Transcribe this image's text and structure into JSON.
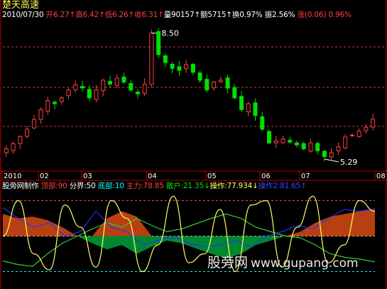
{
  "stock": {
    "name": "楚天高速"
  },
  "header": {
    "date": "2010/07/30",
    "open_label": "开",
    "open": "6.27",
    "high_label": "高",
    "high": "6.42",
    "low_label": "低",
    "low": "6.26",
    "close_label": "收",
    "close": "6.31",
    "volume_label": "量",
    "volume": "90157",
    "amount_label": "额",
    "amount": "5715",
    "turnover_label": "换",
    "turnover": "0.97%",
    "amplitude_label": "振",
    "amplitude": "2.56%",
    "change_label": "涨",
    "change": "(0.06)",
    "change_pct": "0.96%"
  },
  "annotations": {
    "high_mark": "8.50",
    "low_mark": "5.29"
  },
  "x_axis": {
    "labels": [
      "2010",
      "02",
      "03",
      "04",
      "05",
      "06",
      "07",
      "08"
    ]
  },
  "indicator": {
    "name": "股旁网制作",
    "top_label": "顶部",
    "top_value": "90",
    "divide_label": "分界",
    "divide_value": "50",
    "bottom_label": "底部",
    "bottom_value": "10",
    "main_label": "主力",
    "main_value": "78.85",
    "retail_label": "散户",
    "retail_value": "21.35",
    "op_label": "操作",
    "op_value": "77.934",
    "ctrl_label": "操作2",
    "ctrl_value": "81.65"
  },
  "watermark": {
    "text": "股旁网",
    "url": "www.gupang.com"
  },
  "colors": {
    "up": "#ff4040",
    "down": "#00e000",
    "axis": "#b00000",
    "grid": "#c04040",
    "main_fill": "#b84010",
    "retail_fill": "#008830",
    "yellow": "#ffff66",
    "blue": "#2233ff",
    "green_line": "#33cc33",
    "label_cyan": "#00ffff"
  },
  "chart_data": [
    {
      "type": "candlestick",
      "title": "楚天高速",
      "xlabel": "",
      "ylabel": "",
      "x": [
        "2010",
        "02",
        "03",
        "04",
        "05",
        "06",
        "07",
        "08"
      ],
      "ylim": [
        5.0,
        8.8
      ],
      "high_marker": 8.5,
      "low_marker": 5.29,
      "series": [
        {
          "values": [
            5.55,
            5.68,
            5.86,
            6.05,
            6.3,
            6.55,
            6.78,
            6.7,
            6.85,
            7.05,
            7.18,
            7.1,
            6.85,
            7.05,
            7.3,
            7.2,
            7.35,
            7.25,
            7.05,
            6.95,
            7.2,
            8.5,
            7.95,
            7.75,
            7.6,
            7.55,
            7.7,
            7.5,
            7.3,
            7.05,
            7.25,
            7.3,
            7.1,
            6.85,
            6.55,
            6.7,
            6.4,
            6.05,
            5.7,
            5.75,
            5.8,
            5.72,
            5.65,
            5.55,
            5.7,
            5.5,
            5.35,
            5.45,
            5.6,
            5.85,
            5.9,
            6.0,
            6.1,
            6.31
          ]
        }
      ]
    },
    {
      "type": "line",
      "title": "股旁网制作",
      "xlabel": "",
      "ylabel": "",
      "ylim": [
        0,
        100
      ],
      "reference_lines": [
        90,
        50,
        10
      ],
      "series": [
        {
          "name": "主力",
          "values": [
            75,
            70,
            72,
            68,
            60,
            48,
            45,
            70,
            78,
            72,
            50,
            45,
            40,
            35,
            30,
            38,
            42,
            45,
            48,
            50,
            55,
            65,
            72,
            75,
            78,
            80
          ]
        },
        {
          "name": "散户",
          "values": [
            22,
            18,
            16,
            30,
            42,
            50,
            58,
            65,
            60,
            70,
            62,
            55,
            58,
            64,
            70,
            75,
            70,
            60,
            55,
            50,
            48,
            40,
            30,
            26,
            24,
            21
          ]
        },
        {
          "name": "操作",
          "values": [
            50,
            90,
            30,
            12,
            85,
            60,
            15,
            90,
            70,
            10,
            40,
            95,
            20,
            30,
            80,
            10,
            85,
            90,
            15,
            60,
            95,
            20,
            40,
            90,
            78
          ]
        },
        {
          "name": "操作2",
          "values": [
            82,
            70,
            60,
            65,
            50,
            55,
            78,
            60,
            55,
            40,
            45,
            50,
            42,
            38,
            40,
            45,
            38,
            50,
            55,
            62,
            58,
            70,
            80,
            78,
            81
          ]
        }
      ]
    }
  ]
}
